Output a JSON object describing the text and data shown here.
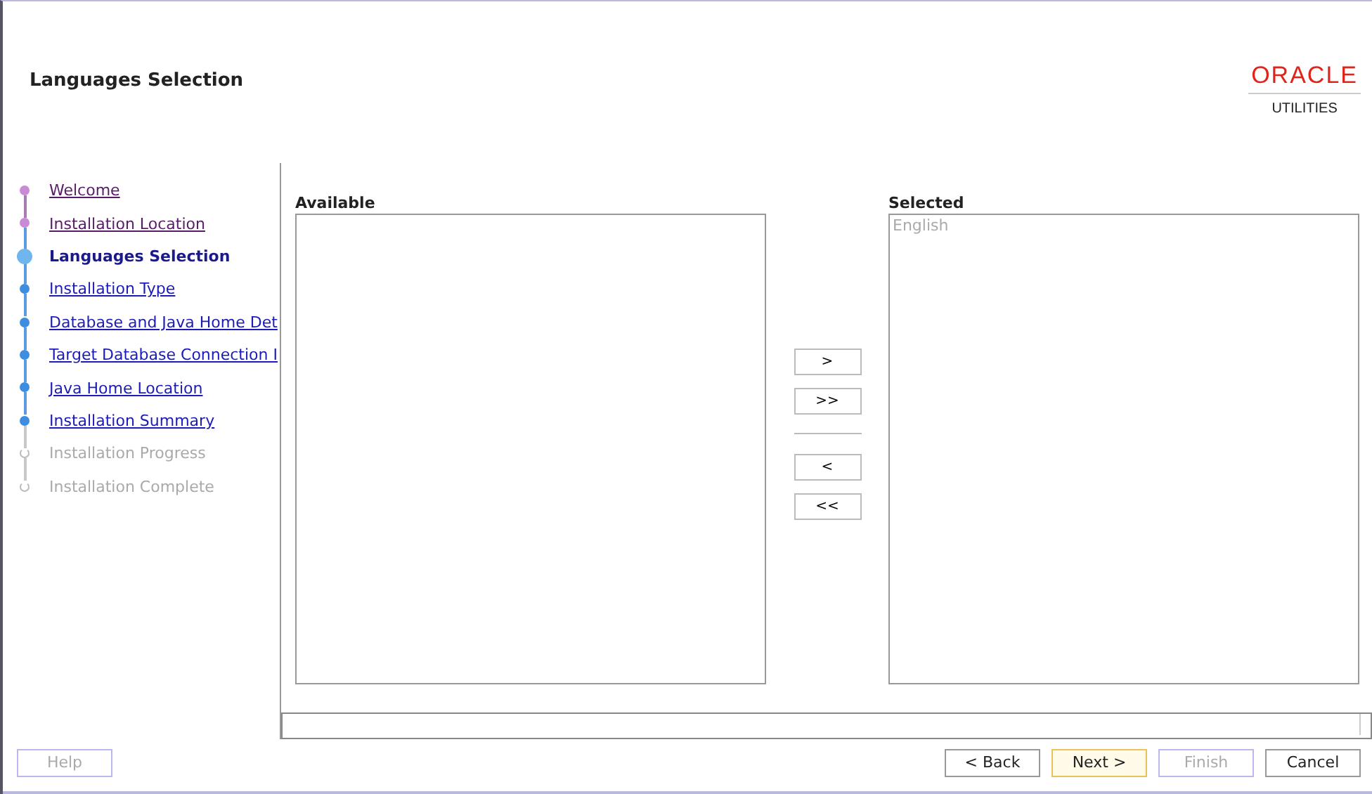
{
  "header": {
    "title": "Languages Selection",
    "logo": "ORACLE",
    "logo_sub": "UTILITIES"
  },
  "steps": [
    {
      "label": "Welcome",
      "visited": true,
      "selected": false,
      "disabled": false
    },
    {
      "label": "Installation Location",
      "visited": true,
      "selected": false,
      "disabled": false
    },
    {
      "label": "Languages Selection",
      "visited": false,
      "selected": true,
      "disabled": false
    },
    {
      "label": "Installation Type",
      "visited": false,
      "selected": false,
      "disabled": false
    },
    {
      "label": "Database and Java Home Det",
      "visited": false,
      "selected": false,
      "disabled": false
    },
    {
      "label": "Target Database Connection I",
      "visited": false,
      "selected": false,
      "disabled": false
    },
    {
      "label": "Java Home Location",
      "visited": false,
      "selected": false,
      "disabled": false
    },
    {
      "label": "Installation Summary",
      "visited": false,
      "selected": false,
      "disabled": false
    },
    {
      "label": "Installation Progress",
      "visited": false,
      "selected": false,
      "disabled": true
    },
    {
      "label": "Installation Complete",
      "visited": false,
      "selected": false,
      "disabled": true
    }
  ],
  "available": {
    "label": "Available"
  },
  "selected": {
    "label": "Selected",
    "items": [
      {
        "label": "English",
        "disabled": true
      }
    ]
  },
  "move_buttons": [
    ">",
    ">>",
    "<",
    "<<"
  ],
  "footer": {
    "help": {
      "label": "Help",
      "disabled": true
    },
    "buttons": [
      {
        "label": "< Back",
        "disabled": false,
        "focused": false
      },
      {
        "label": "Next >",
        "disabled": false,
        "focused": true
      },
      {
        "label": "Finish",
        "disabled": true,
        "focused": false
      },
      {
        "label": "Cancel",
        "disabled": false,
        "focused": false
      }
    ]
  }
}
